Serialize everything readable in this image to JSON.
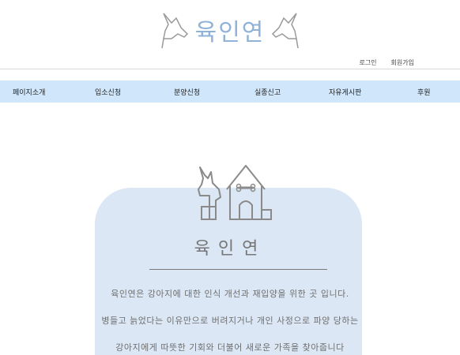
{
  "header": {
    "logo_text": "육인연",
    "login_label": "로그인",
    "signup_label": "회원가입"
  },
  "nav": {
    "items": [
      {
        "label": "페이지소개"
      },
      {
        "label": "입소신청"
      },
      {
        "label": "분양신청"
      },
      {
        "label": "실종신고"
      },
      {
        "label": "자유게시판"
      },
      {
        "label": "후원"
      }
    ]
  },
  "main": {
    "title": "육인연",
    "lines": [
      "육인연은 강아지에 대한 인식 개선과  재입양을 위한 곳 입니다.",
      "병들고 늙었다는 이유만으로 버려지거나 개인 사정으로 파양 당하는",
      "강아지에게 따뜻한 기회와 더불어 새로운 가족을 찾아줍니다"
    ]
  },
  "colors": {
    "nav_bg": "#cfe6fb",
    "card_bg": "#dbe7f4",
    "logo": "#8fb2d8"
  }
}
